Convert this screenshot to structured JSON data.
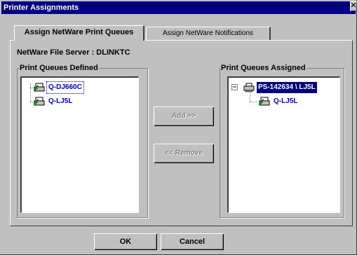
{
  "window": {
    "title": "Printer Assignments",
    "close_glyph": "✕"
  },
  "tabs": [
    {
      "label": "Assign NetWare Print Queues",
      "active": true
    },
    {
      "label": "Assign NetWare Notifications",
      "active": false
    }
  ],
  "server": {
    "label": "NetWare File Server : DLINKTC"
  },
  "defined": {
    "title": "Print Queues Defined",
    "items": [
      {
        "label": "Q-DJ660C",
        "icon": "print-queue-icon",
        "focused": true
      },
      {
        "label": "Q-LJ5L",
        "icon": "print-queue-icon"
      }
    ]
  },
  "assigned": {
    "title": "Print Queues Assigned",
    "root": {
      "label": "PS-142634 \\ LJ5L",
      "icon": "printer-icon",
      "expander": "−",
      "selected": true
    },
    "children": [
      {
        "label": "Q-LJ5L",
        "icon": "print-queue-icon"
      }
    ]
  },
  "buttons": {
    "add": "Add >>",
    "remove": "<< Remove",
    "ok": "OK",
    "cancel": "Cancel"
  },
  "colors": {
    "title_bar": "#000080",
    "dialog_bg": "#c0c0c0",
    "tree_text": "#0000c0"
  }
}
